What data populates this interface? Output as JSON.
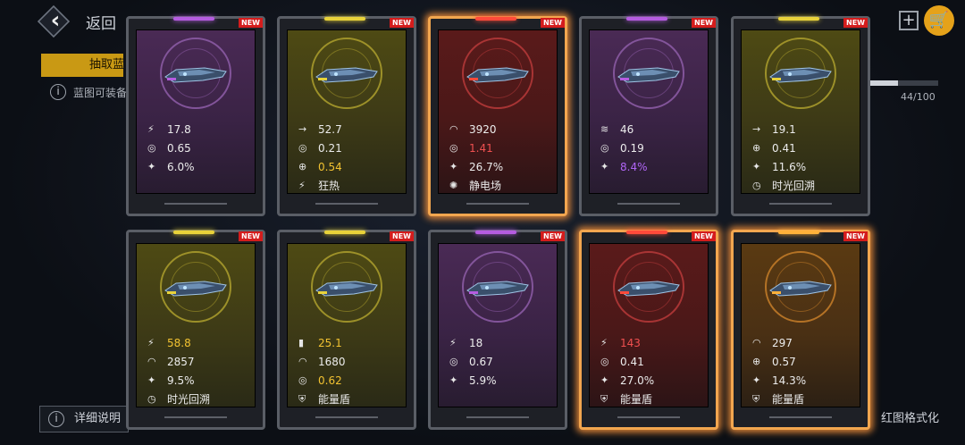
{
  "header": {
    "back_label": "返回",
    "plus_label": "+",
    "cart_label": "🛒"
  },
  "background": {
    "extract_tab": "抽取蓝",
    "hint_text": "蓝图可装备",
    "progress_text": "44/100",
    "progress_fraction": 0.44,
    "help_label": "详细说明",
    "format_label": "红图格式化"
  },
  "cards": [
    {
      "tier": "purple",
      "new": "NEW",
      "glow": false,
      "stats": [
        {
          "icon": "dps-icon",
          "glyph": "⚡",
          "value": "17.8",
          "hl": ""
        },
        {
          "icon": "cooldown-icon",
          "glyph": "◎",
          "value": "0.65",
          "hl": ""
        },
        {
          "icon": "crit-icon",
          "glyph": "✦",
          "value": "6.0%",
          "hl": ""
        }
      ]
    },
    {
      "tier": "yellow",
      "new": "NEW",
      "glow": false,
      "stats": [
        {
          "icon": "speed-icon",
          "glyph": "→",
          "value": "52.7",
          "hl": ""
        },
        {
          "icon": "cooldown-icon",
          "glyph": "◎",
          "value": "0.21",
          "hl": ""
        },
        {
          "icon": "accuracy-icon",
          "glyph": "⊕",
          "value": "0.54",
          "hl": "yellow"
        },
        {
          "icon": "frenzy-icon",
          "glyph": "⚡",
          "value": "狂热",
          "hl": ""
        }
      ]
    },
    {
      "tier": "red",
      "new": "NEW",
      "glow": true,
      "stats": [
        {
          "icon": "shield-arc-icon",
          "glyph": "◠",
          "value": "3920",
          "hl": ""
        },
        {
          "icon": "cooldown-icon",
          "glyph": "◎",
          "value": "1.41",
          "hl": "red"
        },
        {
          "icon": "crit-icon",
          "glyph": "✦",
          "value": "26.7%",
          "hl": ""
        },
        {
          "icon": "static-field-icon",
          "glyph": "✺",
          "value": "静电场",
          "hl": ""
        }
      ]
    },
    {
      "tier": "purple",
      "new": "NEW",
      "glow": false,
      "stats": [
        {
          "icon": "missile-icon",
          "glyph": "≋",
          "value": "46",
          "hl": ""
        },
        {
          "icon": "cooldown-icon",
          "glyph": "◎",
          "value": "0.19",
          "hl": ""
        },
        {
          "icon": "crit-icon",
          "glyph": "✦",
          "value": "8.4%",
          "hl": "purple"
        }
      ]
    },
    {
      "tier": "yellow",
      "new": "NEW",
      "glow": false,
      "stats": [
        {
          "icon": "speed-icon",
          "glyph": "→",
          "value": "19.1",
          "hl": ""
        },
        {
          "icon": "accuracy-icon",
          "glyph": "⊕",
          "value": "0.41",
          "hl": ""
        },
        {
          "icon": "crit-icon",
          "glyph": "✦",
          "value": "11.6%",
          "hl": ""
        },
        {
          "icon": "time-rewind-icon",
          "glyph": "◷",
          "value": "时光回溯",
          "hl": ""
        }
      ]
    },
    {
      "tier": "yellow",
      "new": "NEW",
      "glow": false,
      "stats": [
        {
          "icon": "dps-icon",
          "glyph": "⚡",
          "value": "58.8",
          "hl": "yellow"
        },
        {
          "icon": "shield-arc-icon",
          "glyph": "◠",
          "value": "2857",
          "hl": ""
        },
        {
          "icon": "crit-icon",
          "glyph": "✦",
          "value": "9.5%",
          "hl": ""
        },
        {
          "icon": "time-rewind-icon",
          "glyph": "◷",
          "value": "时光回溯",
          "hl": ""
        }
      ]
    },
    {
      "tier": "yellow",
      "new": "NEW",
      "glow": false,
      "stats": [
        {
          "icon": "damage-bars-icon",
          "glyph": "▮",
          "value": "25.1",
          "hl": "yellow"
        },
        {
          "icon": "shield-arc-icon",
          "glyph": "◠",
          "value": "1680",
          "hl": ""
        },
        {
          "icon": "cooldown-icon",
          "glyph": "◎",
          "value": "0.62",
          "hl": "yellow"
        },
        {
          "icon": "energy-shield-icon",
          "glyph": "⛨",
          "value": "能量盾",
          "hl": ""
        }
      ]
    },
    {
      "tier": "purple",
      "new": "NEW",
      "glow": false,
      "stats": [
        {
          "icon": "dps-icon",
          "glyph": "⚡",
          "value": "18",
          "hl": ""
        },
        {
          "icon": "cooldown-icon",
          "glyph": "◎",
          "value": "0.67",
          "hl": ""
        },
        {
          "icon": "crit-icon",
          "glyph": "✦",
          "value": "5.9%",
          "hl": ""
        }
      ]
    },
    {
      "tier": "red",
      "new": "NEW",
      "glow": true,
      "stats": [
        {
          "icon": "dps-icon",
          "glyph": "⚡",
          "value": "143",
          "hl": "red"
        },
        {
          "icon": "cooldown-icon",
          "glyph": "◎",
          "value": "0.41",
          "hl": ""
        },
        {
          "icon": "crit-icon",
          "glyph": "✦",
          "value": "27.0%",
          "hl": ""
        },
        {
          "icon": "energy-shield-icon",
          "glyph": "⛨",
          "value": "能量盾",
          "hl": ""
        }
      ]
    },
    {
      "tier": "orange",
      "new": "NEW",
      "glow": true,
      "stats": [
        {
          "icon": "shield-arc-icon",
          "glyph": "◠",
          "value": "297",
          "hl": ""
        },
        {
          "icon": "accuracy-icon",
          "glyph": "⊕",
          "value": "0.57",
          "hl": ""
        },
        {
          "icon": "crit-icon",
          "glyph": "✦",
          "value": "14.3%",
          "hl": ""
        },
        {
          "icon": "energy-shield-icon",
          "glyph": "⛨",
          "value": "能量盾",
          "hl": ""
        }
      ]
    }
  ],
  "colors": {
    "yellow_bar": "#e8d23a",
    "purple_bar": "#b55ce0",
    "red_bar": "#ff4a3a",
    "orange_bar": "#ffb13a"
  }
}
